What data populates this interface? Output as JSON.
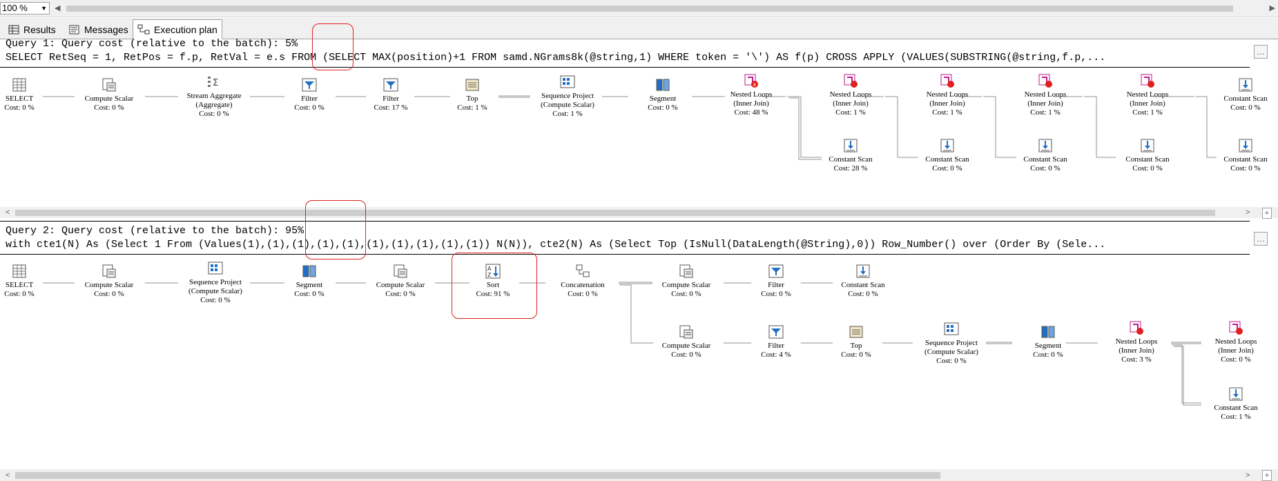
{
  "zoom": {
    "value": "100 %"
  },
  "tabs": [
    {
      "label": "Results",
      "icon": "grid-icon"
    },
    {
      "label": "Messages",
      "icon": "messages-icon"
    },
    {
      "label": "Execution plan",
      "icon": "plan-icon"
    }
  ],
  "query1": {
    "title": "Query 1: Query cost (relative to the batch): 5%",
    "sql": "SELECT RetSeq = 1, RetPos = f.p, RetVal = e.s FROM (SELECT MAX(position)+1 FROM samd.NGrams8k(@string,1) WHERE token = '\\') AS f(p) CROSS APPLY (VALUES(SUBSTRING(@string,f.p,...",
    "nodes": [
      {
        "label": "SELECT",
        "cost": "Cost: 0 %",
        "icon": "select-icon"
      },
      {
        "label": "Compute Scalar",
        "cost": "Cost: 0 %",
        "icon": "compute-scalar-icon"
      },
      {
        "label": "Stream Aggregate\n(Aggregate)",
        "cost": "Cost: 0 %",
        "icon": "stream-aggregate-icon"
      },
      {
        "label": "Filter",
        "cost": "Cost: 0 %",
        "icon": "filter-icon"
      },
      {
        "label": "Filter",
        "cost": "Cost: 17 %",
        "icon": "filter-icon"
      },
      {
        "label": "Top",
        "cost": "Cost: 1 %",
        "icon": "top-icon"
      },
      {
        "label": "Sequence Project\n(Compute Scalar)",
        "cost": "Cost: 1 %",
        "icon": "sequence-project-icon"
      },
      {
        "label": "Segment",
        "cost": "Cost: 0 %",
        "icon": "segment-icon"
      },
      {
        "label": "Nested Loops\n(Inner Join)",
        "cost": "Cost: 48 %",
        "icon": "nested-loops-icon"
      },
      {
        "label": "Nested Loops\n(Inner Join)",
        "cost": "Cost: 1 %",
        "icon": "nested-loops-icon"
      },
      {
        "label": "Nested Loops\n(Inner Join)",
        "cost": "Cost: 1 %",
        "icon": "nested-loops-icon"
      },
      {
        "label": "Nested Loops\n(Inner Join)",
        "cost": "Cost: 1 %",
        "icon": "nested-loops-icon"
      },
      {
        "label": "Nested Loops\n(Inner Join)",
        "cost": "Cost: 1 %",
        "icon": "nested-loops-icon"
      },
      {
        "label": "Constant Scan",
        "cost": "Cost: 0 %",
        "icon": "constant-scan-icon"
      },
      {
        "label": "Constant Scan",
        "cost": "Cost: 28 %",
        "icon": "constant-scan-icon"
      },
      {
        "label": "Constant Scan",
        "cost": "Cost: 0 %",
        "icon": "constant-scan-icon"
      },
      {
        "label": "Constant Scan",
        "cost": "Cost: 0 %",
        "icon": "constant-scan-icon"
      },
      {
        "label": "Constant Scan",
        "cost": "Cost: 0 %",
        "icon": "constant-scan-icon"
      },
      {
        "label": "Constant Scan",
        "cost": "Cost: 0 %",
        "icon": "constant-scan-icon"
      }
    ]
  },
  "query2": {
    "title": "Query 2: Query cost (relative to the batch): 95%",
    "sql": "with cte1(N) As (Select 1 From (Values(1),(1),(1),(1),(1),(1),(1),(1),(1),(1)) N(N)), cte2(N) As (Select Top (IsNull(DataLength(@String),0)) Row_Number() over (Order By (Sele...",
    "nodes": [
      {
        "label": "SELECT",
        "cost": "Cost: 0 %",
        "icon": "select-icon"
      },
      {
        "label": "Compute Scalar",
        "cost": "Cost: 0 %",
        "icon": "compute-scalar-icon"
      },
      {
        "label": "Sequence Project\n(Compute Scalar)",
        "cost": "Cost: 0 %",
        "icon": "sequence-project-icon"
      },
      {
        "label": "Segment",
        "cost": "Cost: 0 %",
        "icon": "segment-icon"
      },
      {
        "label": "Compute Scalar",
        "cost": "Cost: 0 %",
        "icon": "compute-scalar-icon"
      },
      {
        "label": "Sort",
        "cost": "Cost: 91 %",
        "icon": "sort-icon"
      },
      {
        "label": "Concatenation",
        "cost": "Cost: 0 %",
        "icon": "concatenation-icon"
      },
      {
        "label": "Compute Scalar",
        "cost": "Cost: 0 %",
        "icon": "compute-scalar-icon"
      },
      {
        "label": "Filter",
        "cost": "Cost: 0 %",
        "icon": "filter-icon"
      },
      {
        "label": "Constant Scan",
        "cost": "Cost: 0 %",
        "icon": "constant-scan-icon"
      },
      {
        "label": "Compute Scalar",
        "cost": "Cost: 0 %",
        "icon": "compute-scalar-icon"
      },
      {
        "label": "Filter",
        "cost": "Cost: 4 %",
        "icon": "filter-icon"
      },
      {
        "label": "Top",
        "cost": "Cost: 0 %",
        "icon": "top-icon"
      },
      {
        "label": "Sequence Project\n(Compute Scalar)",
        "cost": "Cost: 0 %",
        "icon": "sequence-project-icon"
      },
      {
        "label": "Segment",
        "cost": "Cost: 0 %",
        "icon": "segment-icon"
      },
      {
        "label": "Nested Loops\n(Inner Join)",
        "cost": "Cost: 3 %",
        "icon": "nested-loops-icon"
      },
      {
        "label": "Nested Loops\n(Inner Join)",
        "cost": "Cost: 0 %",
        "icon": "nested-loops-icon"
      },
      {
        "label": "Constant Scan",
        "cost": "Cost: 1 %",
        "icon": "constant-scan-icon"
      }
    ]
  },
  "colors": {
    "highlight": "#e02020",
    "accent": "#1f6fc5",
    "nestedLoops": "#c0198a"
  }
}
